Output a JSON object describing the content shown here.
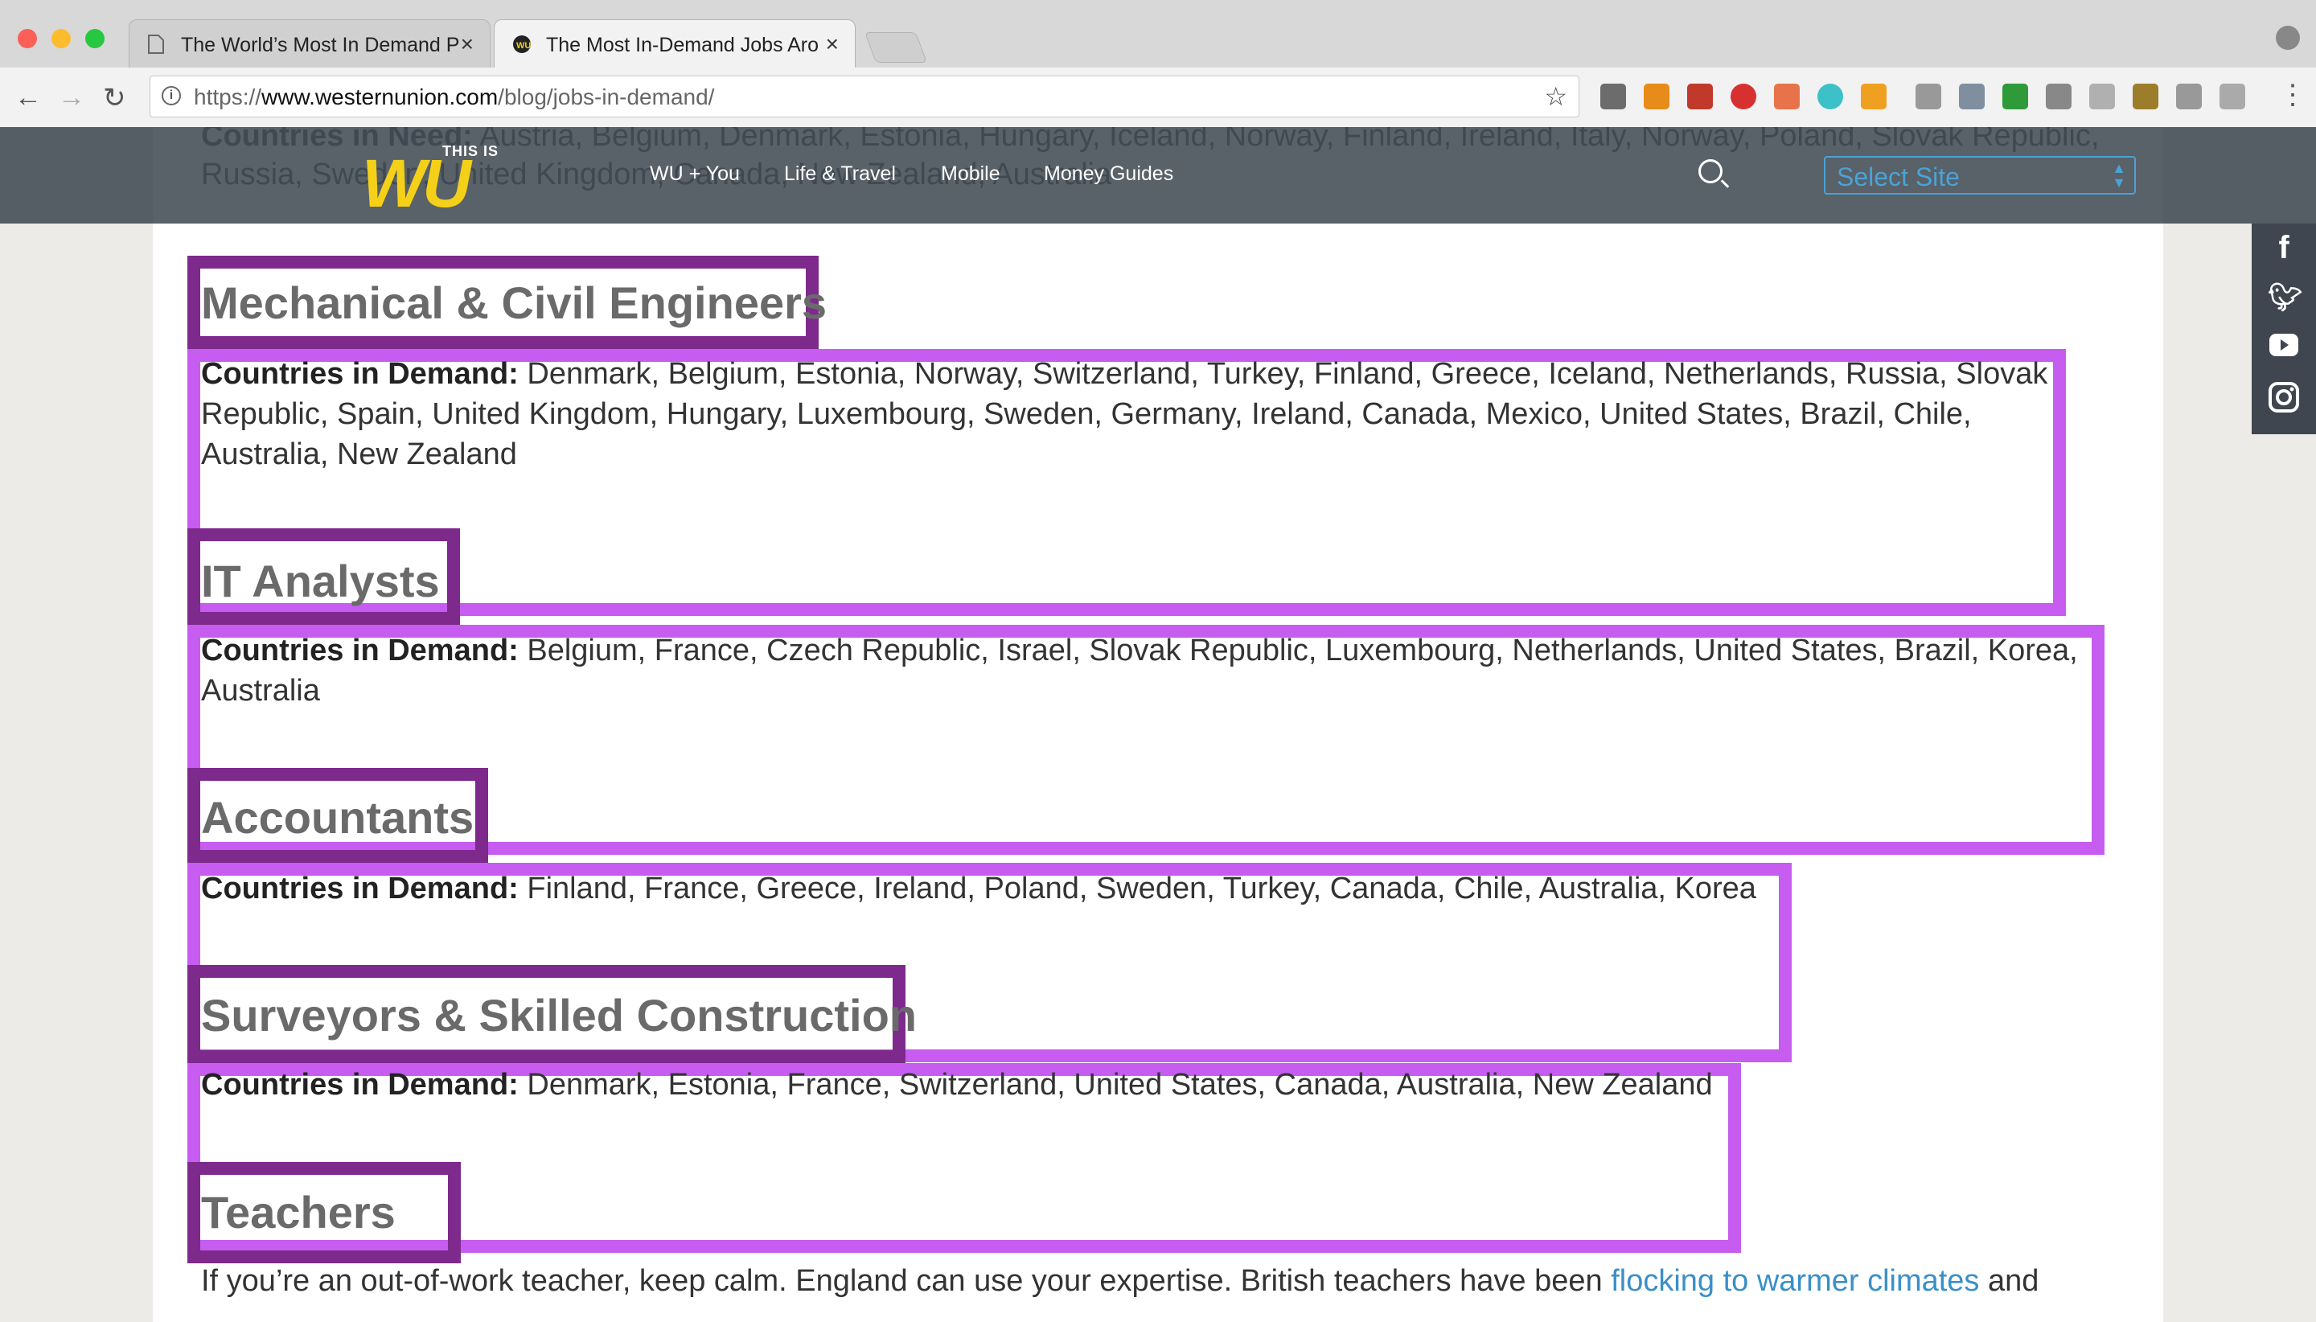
{
  "browser": {
    "tabs": [
      {
        "title": "The World’s Most In Demand P",
        "active": false
      },
      {
        "title": "The Most In-Demand Jobs Aro",
        "active": true
      }
    ],
    "url_prefix": "https://",
    "url_domain": "www.westernunion.com",
    "url_path": "/blog/jobs-in-demand/"
  },
  "site": {
    "logo_small": "THIS IS",
    "logo_main": "WU",
    "nav": [
      "WU + You",
      "Life & Travel",
      "Mobile",
      "Money Guides"
    ],
    "select_site": "Select Site",
    "behind_line1_label": "Countries in Need:",
    "behind_line1": "Austria, Belgium, Denmark, Estonia, Hungary, Iceland, Norway, Finland, Ireland, Italy, Norway, Poland, Slovak Republic,",
    "behind_line2": "Russia, Sweden, United Kingdom, Canada, New Zealand, Australia"
  },
  "sections": [
    {
      "title": "Mechanical & Civil Engineers",
      "label": "Countries in Demand:",
      "lines": [
        " Denmark, Belgium, Estonia, Norway, Switzerland, Turkey, Finland, Greece, Iceland, Netherlands, Russia, Slovak",
        "Republic, Spain, United Kingdom, Hungary, Luxembourg, Sweden, Germany, Ireland, Canada, Mexico, United States, Brazil, Chile,",
        "Australia, New Zealand"
      ]
    },
    {
      "title": "IT Analysts",
      "label": "Countries in Demand:",
      "lines": [
        " Belgium, France, Czech Republic, Israel, Slovak Republic, Luxembourg, Netherlands, United States, Brazil, Korea,",
        "Australia"
      ]
    },
    {
      "title": "Accountants",
      "label": "Countries in Demand:",
      "lines": [
        " Finland, France, Greece, Ireland, Poland, Sweden, Turkey, Canada, Chile, Australia, Korea"
      ]
    },
    {
      "title": "Surveyors & Skilled Construction",
      "label": "Countries in Demand:",
      "lines": [
        " Denmark, Estonia, France, Switzerland, United States, Canada, Australia, New Zealand"
      ]
    },
    {
      "title": "Teachers"
    }
  ],
  "teachers_text": "If you’re an out-of-work teacher, keep calm. England can use your expertise. British teachers have been ",
  "teachers_link": "flocking to warmer climates",
  "teachers_after": " and",
  "social_icons": [
    "facebook-icon",
    "twitter-icon",
    "youtube-icon",
    "instagram-icon"
  ],
  "colors": {
    "header_box": "#7d2a8c",
    "para_box": "#c65cf0",
    "link": "#3a8fc7",
    "logo_yellow": "#f5d018"
  }
}
